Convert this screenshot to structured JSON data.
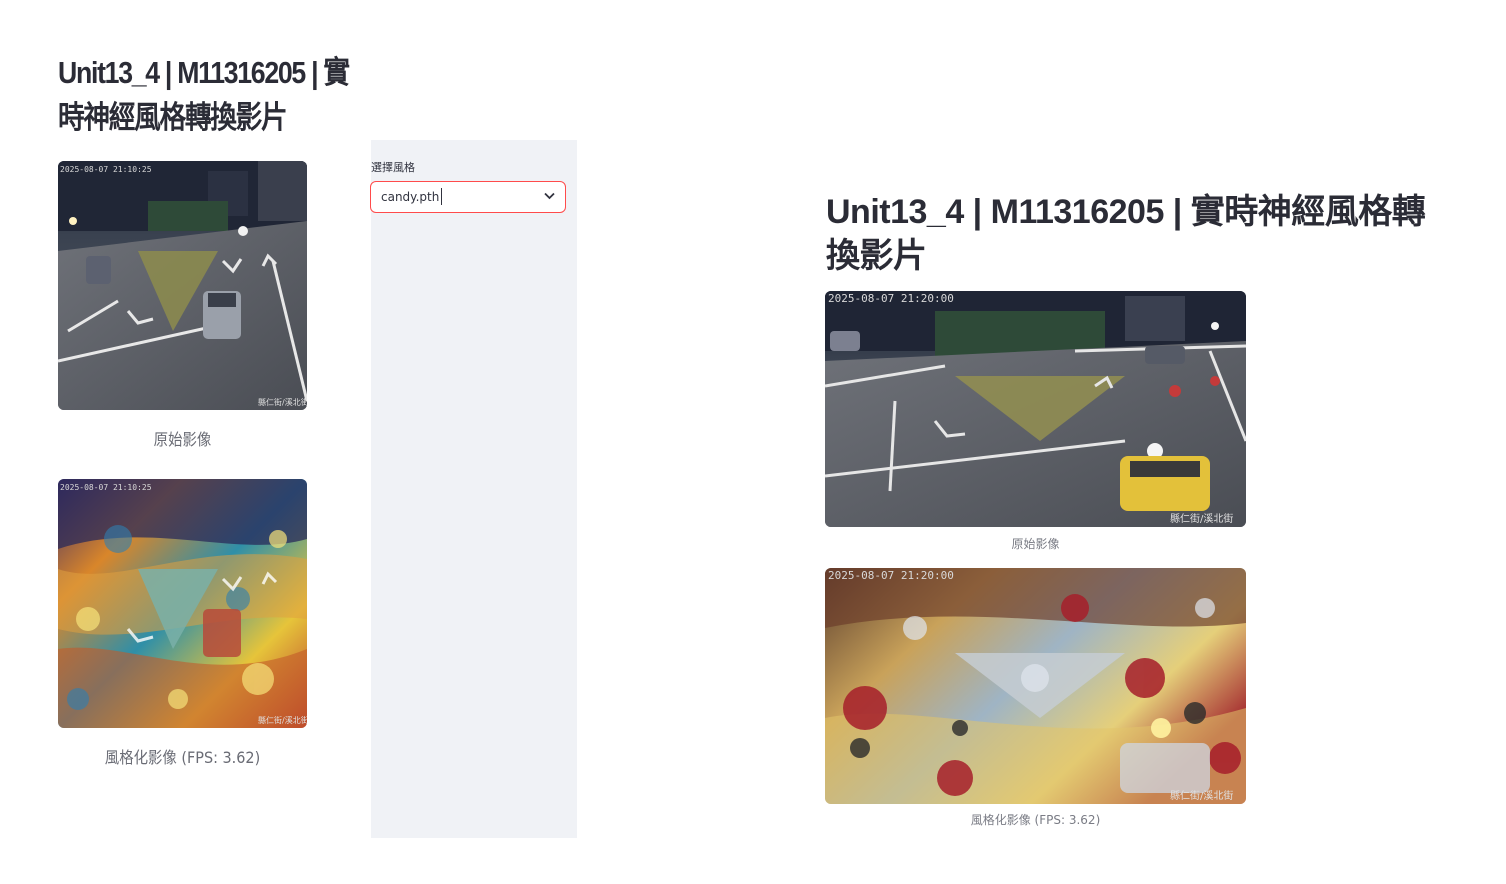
{
  "app": {
    "title": "Unit13_4 | M11316205 | 實時神經風格轉換影片"
  },
  "sidebar": {
    "select_label": "選擇風格",
    "select_value": "candy.pth"
  },
  "original": {
    "caption": "原始影像",
    "timestamp_left": "2025-08-07  21:10:25",
    "timestamp_right": "2025-08-07  21:20:00",
    "watermark": "縣仁街/溪北街"
  },
  "stylized": {
    "caption": "風格化影像 (FPS: 3.62)"
  },
  "icons": {
    "dropdown": "chevron-down-icon"
  },
  "colors": {
    "accent": "#ff4b4b",
    "sidebar_bg": "#f0f2f6",
    "text": "#31333f"
  }
}
